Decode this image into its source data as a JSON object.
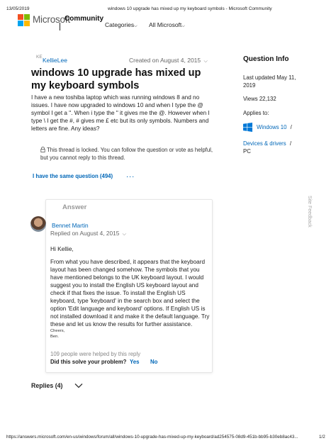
{
  "print_header": {
    "date": "13/05/2019",
    "page_title": "windows 10 upgrade has mixed up my keyboard symbols - Microsoft Community"
  },
  "brand": {
    "logo_colors": [
      "#f25022",
      "#7fba00",
      "#00a4ef",
      "#ffb900"
    ],
    "name": "Microsoft",
    "site": "Community"
  },
  "nav": {
    "categories": "Categories",
    "all_microsoft": "All Microsoft"
  },
  "question": {
    "avatar_initials": "KE",
    "author": "KellieLee",
    "created": "Created on August 4, 2015",
    "title": "windows 10 upgrade has mixed up my keyboard symbols",
    "body": "I have a new toshiba laptop which was running windows 8 and no issues. I have now upgraded to windows 10 and when I type the @ symbol I get a \". When i type the \" it gives me the @. However when I type \\ I get the #, # gives me £ etc but its only symbols. Numbers and letters are fine. Any ideas?",
    "locked_text": "This thread is locked. You can follow the question or vote as helpful, but you cannot reply to this thread.",
    "same_question": "I have the same question (494)",
    "more": "..."
  },
  "answer": {
    "label": "Answer",
    "author": "Bennet Martin",
    "replied": "Replied on August 4, 2015",
    "greeting": "Hi Kellie,",
    "body": "From what you have described, it appears that the keyboard layout has been changed somehow. The symbols that you have mentioned belongs to the UK keyboard layout. I would suggest you to install the English US keyboard layout and check if that fixes the issue. To install  the English US keyboard, type 'keyboard' in the search box and select the option 'Edit language and keyboard' options. If English US is not installed download it and make it the default language. Try these and let us know the results for further assistance.",
    "signoff_1": "Cheers,",
    "signoff_2": "Ben.",
    "helped": "109 people were helped by this reply",
    "solve_prompt": "Did this solve your problem?",
    "yes": "Yes",
    "no": "No"
  },
  "replies": {
    "label": "Replies (4)"
  },
  "sidebar": {
    "heading": "Question Info",
    "last_updated_1": "Last updated May 11,",
    "last_updated_2": "2019",
    "views": "Views 22,132",
    "applies_to": "Applies to:",
    "product": "Windows 10",
    "topic_1": "Devices & drivers",
    "topic_2": "PC",
    "slash": "/"
  },
  "feedback_label": "Site Feedback",
  "footer": {
    "url": "https://answers.microsoft.com/en-us/windows/forum/all/windows-10-upgrade-has-mixed-up-my-keyboard/ad254575-08d9-451b-bb95-b30eb8ac43...",
    "page": "1/2"
  }
}
